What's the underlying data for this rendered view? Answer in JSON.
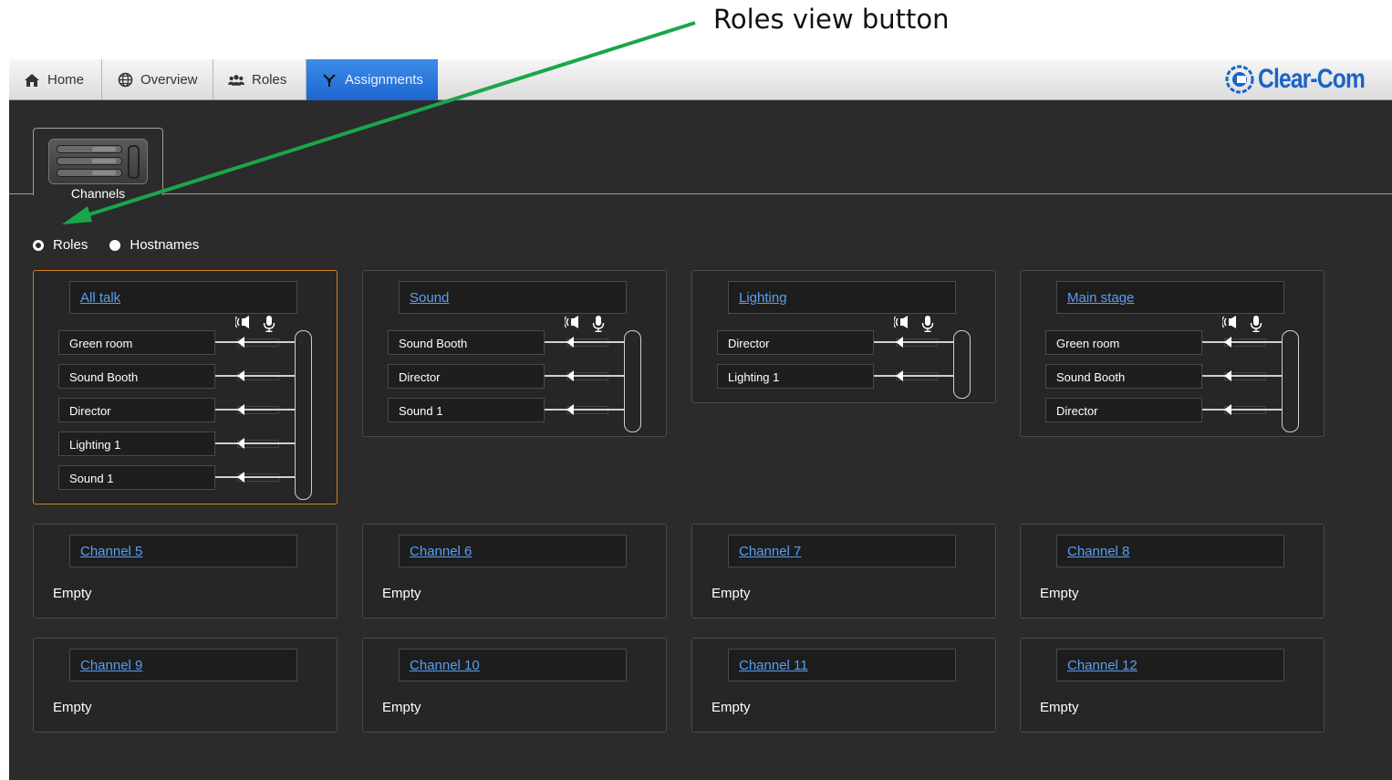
{
  "annotation": {
    "text": "Roles view button",
    "arrow_color": "#1aa64b"
  },
  "navbar": {
    "tabs": [
      {
        "id": "home",
        "label": "Home",
        "icon": "home-icon"
      },
      {
        "id": "overview",
        "label": "Overview",
        "icon": "globe-icon"
      },
      {
        "id": "roles",
        "label": "Roles",
        "icon": "users-icon"
      },
      {
        "id": "assignments",
        "label": "Assignments",
        "icon": "antenna-icon",
        "active": true
      }
    ],
    "logo": "Clear-Com",
    "active_color": "#2476db"
  },
  "channels_tab": {
    "label": "Channels",
    "icon": "channels-icon"
  },
  "view_toggle": {
    "options": [
      {
        "label": "Roles",
        "selected": true
      },
      {
        "label": "Hostnames",
        "selected": false
      }
    ]
  },
  "channels": [
    {
      "title": "All talk",
      "selected": true,
      "roles": [
        "Green room",
        "Sound Booth",
        "Director",
        "Lighting 1",
        "Sound 1"
      ]
    },
    {
      "title": "Sound",
      "roles": [
        "Sound Booth",
        "Director",
        "Sound 1"
      ]
    },
    {
      "title": "Lighting",
      "roles": [
        "Director",
        "Lighting 1"
      ]
    },
    {
      "title": "Main stage",
      "roles": [
        "Green room",
        "Sound Booth",
        "Director"
      ]
    },
    {
      "title": "Channel 5",
      "empty_label": "Empty"
    },
    {
      "title": "Channel 6",
      "empty_label": "Empty"
    },
    {
      "title": "Channel 7",
      "empty_label": "Empty"
    },
    {
      "title": "Channel 8",
      "empty_label": "Empty"
    },
    {
      "title": "Channel 9",
      "empty_label": "Empty"
    },
    {
      "title": "Channel 10",
      "empty_label": "Empty"
    },
    {
      "title": "Channel 11",
      "empty_label": "Empty"
    },
    {
      "title": "Channel 12",
      "empty_label": "Empty"
    }
  ]
}
